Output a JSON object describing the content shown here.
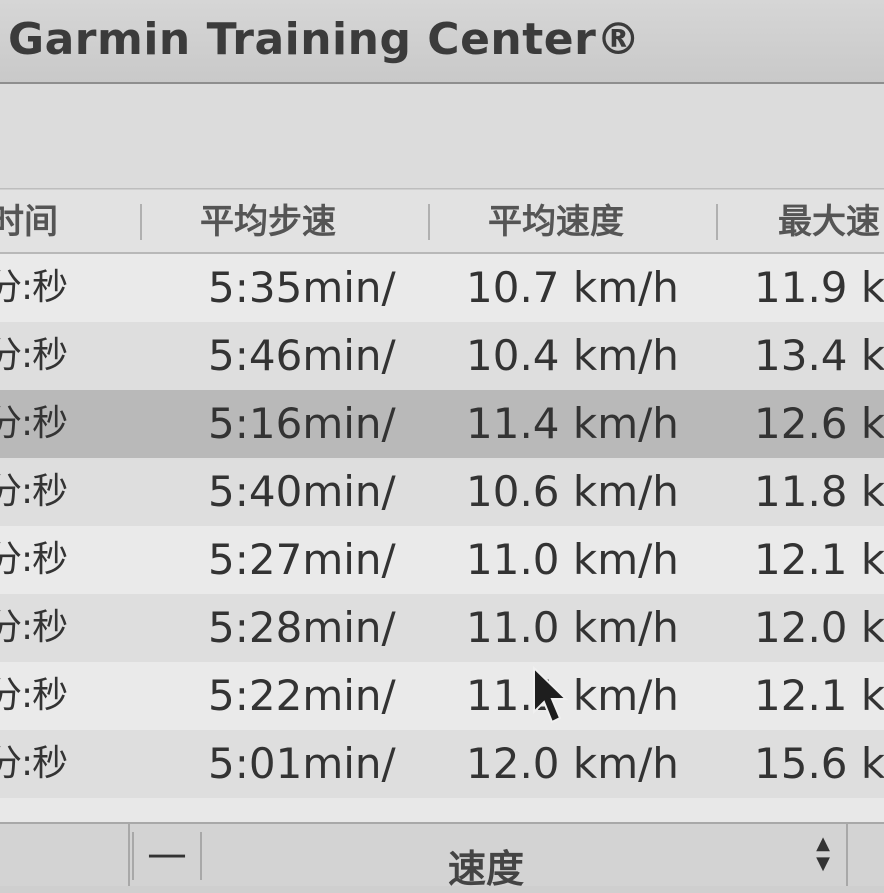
{
  "window": {
    "title": "Garmin Training Center®"
  },
  "table": {
    "columns": [
      "时间",
      "平均步速",
      "平均速度",
      "最大速"
    ],
    "rows": [
      {
        "time": "分:秒",
        "pace": "5:35min/",
        "speed": "10.7 km/h",
        "max": "11.9 k"
      },
      {
        "time": "分:秒",
        "pace": "5:46min/",
        "speed": "10.4 km/h",
        "max": "13.4 k"
      },
      {
        "time": "分:秒",
        "pace": "5:16min/",
        "speed": "11.4 km/h",
        "max": "12.6 k"
      },
      {
        "time": "分:秒",
        "pace": "5:40min/",
        "speed": "10.6 km/h",
        "max": "11.8 k"
      },
      {
        "time": "分:秒",
        "pace": "5:27min/",
        "speed": "11.0 km/h",
        "max": "12.1 k"
      },
      {
        "time": "分:秒",
        "pace": "5:28min/",
        "speed": "11.0 km/h",
        "max": "12.0 k"
      },
      {
        "time": "分:秒",
        "pace": "5:22min/",
        "speed": "11.1 km/h",
        "max": "12.1 k"
      },
      {
        "time": "分:秒",
        "pace": "5:01min/",
        "speed": "12.0 km/h",
        "max": "15.6 k"
      }
    ],
    "selected_row": 2
  },
  "statusbar": {
    "minus_label": "—",
    "field_label": "速度",
    "spin_icon": "spin-updown-icon"
  },
  "colors": {
    "selected_row": "#b9b9b9",
    "background": "#e8e8e8"
  }
}
